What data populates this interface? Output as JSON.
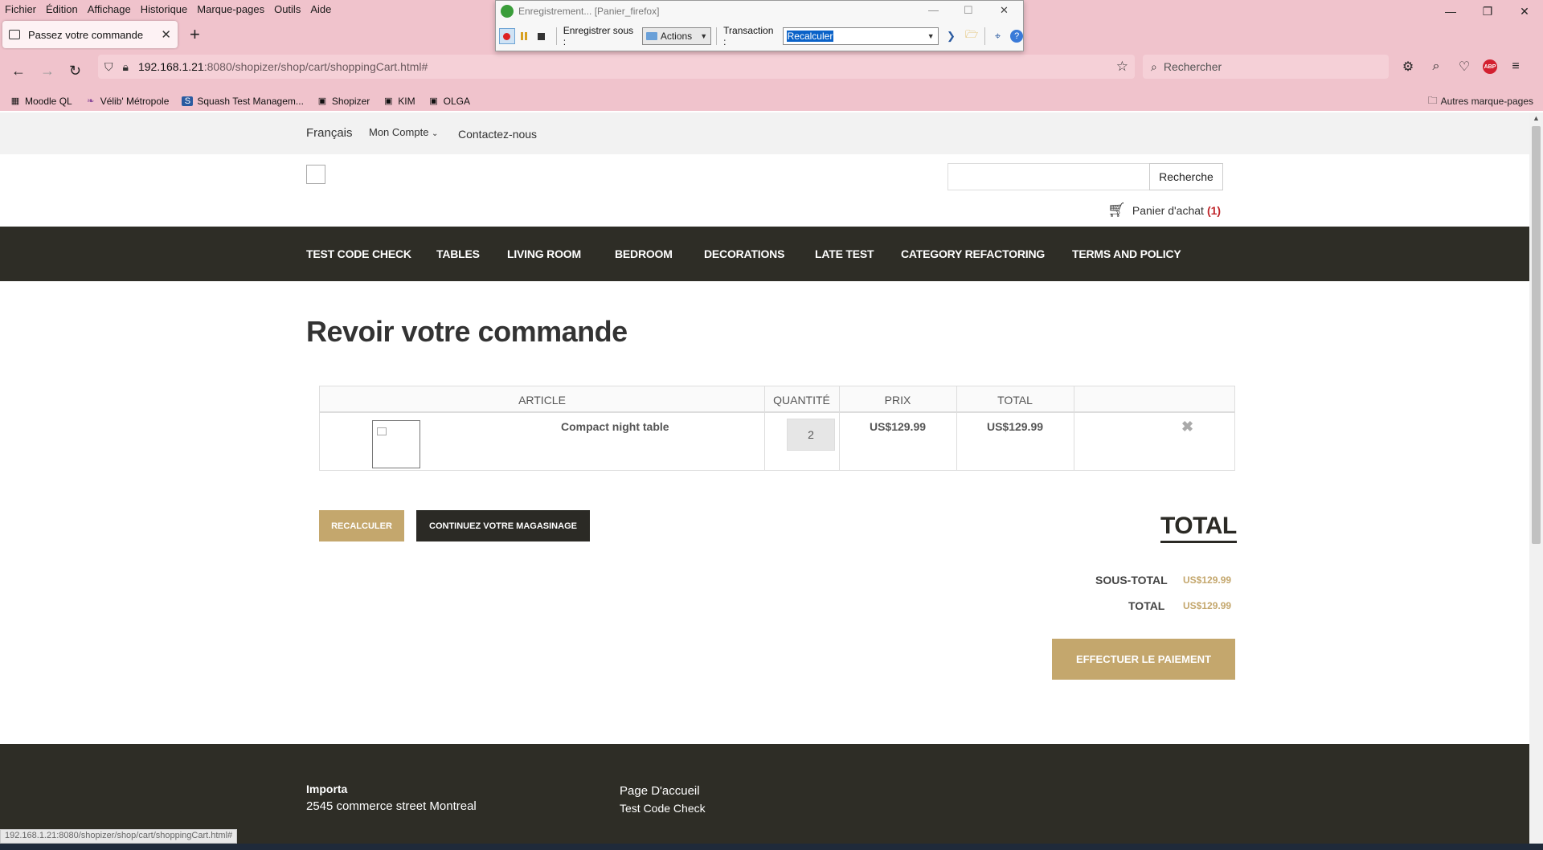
{
  "browser": {
    "menu": [
      "Fichier",
      "Édition",
      "Affichage",
      "Historique",
      "Marque-pages",
      "Outils",
      "Aide"
    ],
    "tab_title": "Passez votre commande",
    "url_host": "192.168.1.21",
    "url_path": ":8080/shopizer/shop/cart/shoppingCart.html#",
    "search_placeholder": "Rechercher",
    "bookmarks": [
      "Moodle QL",
      "Vélib' Métropole",
      "Squash Test Managem...",
      "Shopizer",
      "KIM",
      "OLGA"
    ],
    "other_bookmarks": "Autres marque-pages",
    "status_url": "192.168.1.21:8080/shopizer/shop/cart/shoppingCart.html#"
  },
  "recorder": {
    "title": "Enregistrement... [Panier_firefox]",
    "save_under_label": "Enregistrer sous :",
    "save_under_value": "Actions",
    "transaction_label": "Transaction :",
    "transaction_value": "Recalculer"
  },
  "site": {
    "language": "Français",
    "account": "Mon Compte",
    "contact": "Contactez-nous",
    "search_button": "Recherche",
    "cart_label": "Panier d'achat",
    "cart_count": "(1)",
    "categories": [
      "TEST CODE CHECK",
      "TABLES",
      "LIVING ROOM",
      "BEDROOM",
      "DECORATIONS",
      "LATE TEST",
      "CATEGORY REFACTORING",
      "TERMS AND POLICY"
    ]
  },
  "cart": {
    "page_title": "Revoir votre commande",
    "columns": [
      "ARTICLE",
      "QUANTITÉ",
      "PRIX",
      "TOTAL"
    ],
    "items": [
      {
        "name": "Compact night table",
        "quantity": "2",
        "price": "US$129.99",
        "total": "US$129.99"
      }
    ],
    "recalc_button": "RECALCULER",
    "continue_button": "CONTINUEZ VOTRE MAGASINAGE",
    "total_heading": "TOTAL",
    "subtotal_label": "SOUS-TOTAL",
    "subtotal_value": "US$129.99",
    "total_label": "TOTAL",
    "total_value": "US$129.99",
    "pay_button": "EFFECTUER LE PAIEMENT"
  },
  "footer": {
    "company": "Importa",
    "address": "2545 commerce street Montreal",
    "link_home": "Page D'accueil",
    "link_category": "Test Code Check"
  },
  "colors": {
    "browser_chrome": "#f0c3cc",
    "nav_dark": "#2e2d26",
    "accent_gold": "#c4a76d",
    "cart_count_red": "#c0262a"
  }
}
